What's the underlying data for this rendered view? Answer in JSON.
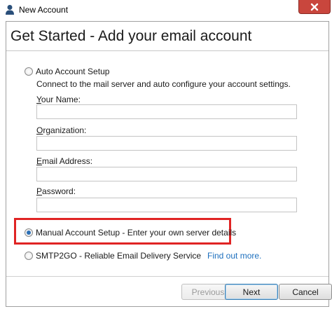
{
  "window": {
    "title": "New Account"
  },
  "header": {
    "title": "Get Started - Add your email account"
  },
  "auto_setup": {
    "label": "Auto Account Setup",
    "description": "Connect to the mail server and auto configure your account settings.",
    "selected": false,
    "fields": {
      "name": {
        "label_prefix": "Y",
        "label_rest": "our Name:",
        "value": ""
      },
      "organization": {
        "label_prefix": "O",
        "label_rest": "rganization:",
        "value": ""
      },
      "email": {
        "label_prefix": "E",
        "label_rest": "mail Address:",
        "value": ""
      },
      "password": {
        "label_prefix": "P",
        "label_rest": "assword:",
        "value": ""
      }
    }
  },
  "manual_setup": {
    "label": "Manual Account Setup - Enter your own server details",
    "selected": true
  },
  "smtp2go": {
    "label": "SMTP2GO - Reliable Email Delivery Service",
    "selected": false,
    "link": "Find out more."
  },
  "buttons": {
    "previous": "Previous",
    "next": "Next",
    "cancel": "Cancel"
  },
  "colors": {
    "highlight": "#e02424",
    "link": "#1c6fbe",
    "close": "#c9463d",
    "radio_dot": "#2c6fb5"
  }
}
